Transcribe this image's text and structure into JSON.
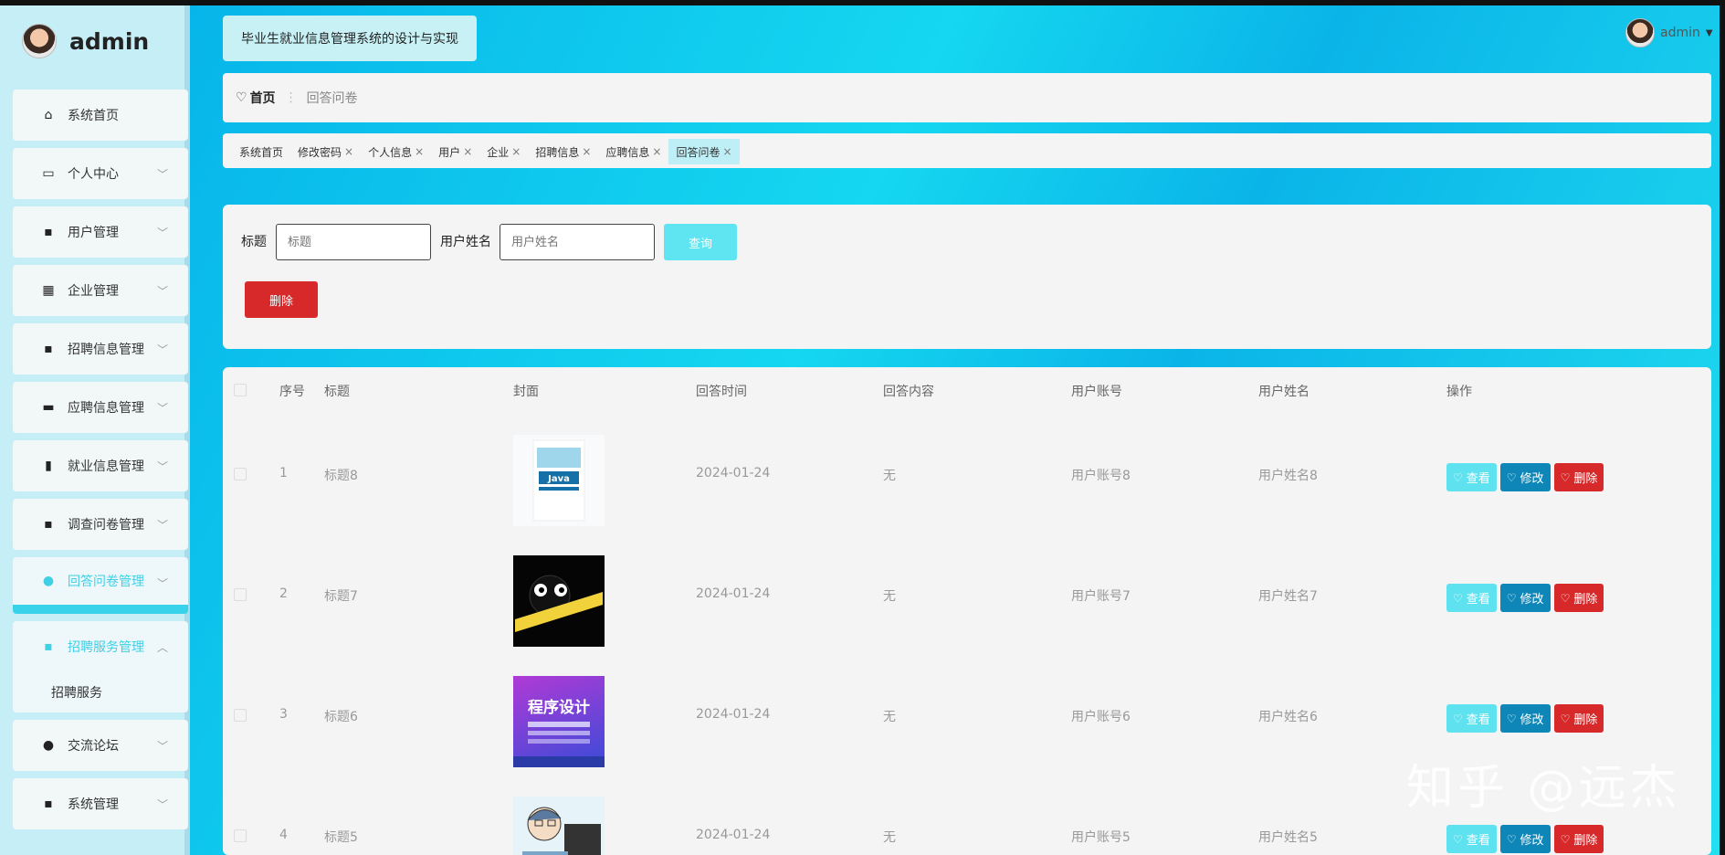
{
  "brand": {
    "name": "admin"
  },
  "sidebar": {
    "items": [
      {
        "label": "系统首页",
        "icon": "home-icon"
      },
      {
        "label": "个人中心",
        "icon": "card-icon"
      },
      {
        "label": "用户管理",
        "icon": "grid-icon"
      },
      {
        "label": "企业管理",
        "icon": "apps-icon"
      },
      {
        "label": "招聘信息管理",
        "icon": "grid-icon"
      },
      {
        "label": "应聘信息管理",
        "icon": "wallet-icon"
      },
      {
        "label": "就业信息管理",
        "icon": "book-icon"
      },
      {
        "label": "调查问卷管理",
        "icon": "grid-icon"
      },
      {
        "label": "回答问卷管理",
        "icon": "user-icon"
      },
      {
        "label": "招聘服务管理",
        "icon": "grid-icon"
      },
      {
        "label": "交流论坛",
        "icon": "pin-icon"
      },
      {
        "label": "系统管理",
        "icon": "grid-icon"
      }
    ],
    "subitem": "招聘服务"
  },
  "header": {
    "title": "毕业生就业信息管理系统的设计与实现",
    "user": "admin"
  },
  "breadcrumb": {
    "home": "首页",
    "current": "回答问卷"
  },
  "tabs": [
    {
      "label": "系统首页",
      "closable": false
    },
    {
      "label": "修改密码",
      "closable": true
    },
    {
      "label": "个人信息",
      "closable": true
    },
    {
      "label": "用户",
      "closable": true
    },
    {
      "label": "企业",
      "closable": true
    },
    {
      "label": "招聘信息",
      "closable": true
    },
    {
      "label": "应聘信息",
      "closable": true
    },
    {
      "label": "回答问卷",
      "closable": true
    }
  ],
  "search": {
    "title_label": "标题",
    "title_placeholder": "标题",
    "username_label": "用户姓名",
    "username_placeholder": "用户姓名",
    "query_button": "查询",
    "delete_button": "删除"
  },
  "table": {
    "headers": [
      "序号",
      "标题",
      "封面",
      "回答时间",
      "回答内容",
      "用户账号",
      "用户姓名",
      "操作"
    ],
    "rows": [
      {
        "index": "1",
        "title": "标题8",
        "time": "2024-01-24",
        "content": "无",
        "account": "用户账号8",
        "name": "用户姓名8"
      },
      {
        "index": "2",
        "title": "标题7",
        "time": "2024-01-24",
        "content": "无",
        "account": "用户账号7",
        "name": "用户姓名7"
      },
      {
        "index": "3",
        "title": "标题6",
        "time": "2024-01-24",
        "content": "无",
        "account": "用户账号6",
        "name": "用户姓名6"
      },
      {
        "index": "4",
        "title": "标题5",
        "time": "2024-01-24",
        "content": "无",
        "account": "用户账号5",
        "name": "用户姓名5"
      }
    ],
    "actions": {
      "view": "查看",
      "edit": "修改",
      "delete": "删除"
    },
    "covers": [
      {
        "text": "Java"
      },
      {
        "text": ""
      },
      {
        "text": "程序设计"
      },
      {
        "text": ""
      }
    ]
  },
  "watermark": "知乎 @远杰"
}
